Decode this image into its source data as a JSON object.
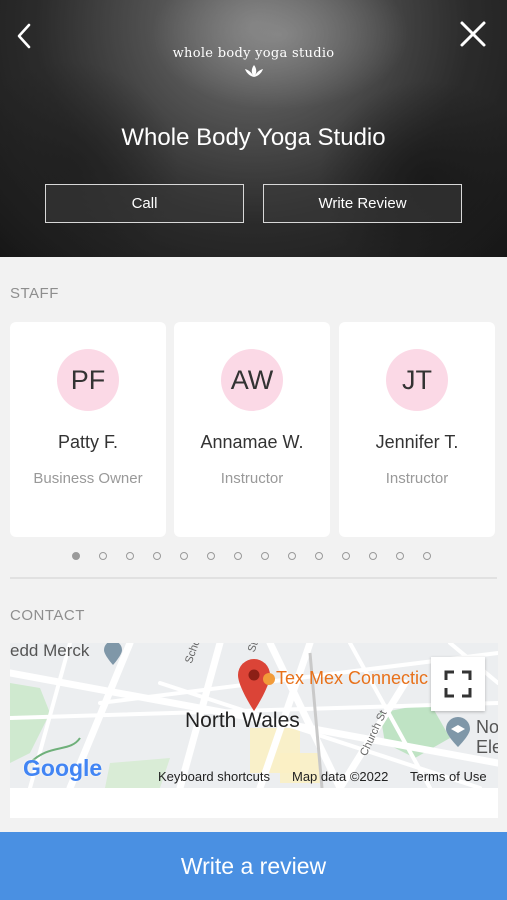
{
  "header": {
    "logo_text": "whole body yoga studio",
    "title": "Whole Body Yoga Studio",
    "call_label": "Call",
    "write_review_label": "Write Review",
    "back_icon": "chevron-left-icon",
    "close_icon": "close-icon"
  },
  "staff": {
    "section_label": "STAFF",
    "members": [
      {
        "initials": "PF",
        "name": "Patty F.",
        "role": "Business Owner"
      },
      {
        "initials": "AW",
        "name": "Annamae W.",
        "role": "Instructor"
      },
      {
        "initials": "JT",
        "name": "Jennifer T.",
        "role": "Instructor"
      }
    ],
    "page_count": 14,
    "active_page": 1
  },
  "contact": {
    "section_label": "CONTACT",
    "map": {
      "place_label": "North Wales",
      "poi_label": "Tex Mex Connectic",
      "edge_label": "edd Merck",
      "right_label_1": "No",
      "right_label_2": "Ele",
      "street_1": "School St",
      "street_2": "Church St",
      "street_3": "St",
      "google": "Google",
      "keyboard_shortcuts": "Keyboard shortcuts",
      "map_data": "Map data ©2022",
      "terms": "Terms of Use"
    }
  },
  "footer": {
    "write_a_review_label": "Write a review"
  },
  "colors": {
    "accent": "#4a90e2",
    "avatar_bg": "#fbd9e6",
    "pin": "#db4437",
    "poi_text": "#e8711a"
  }
}
